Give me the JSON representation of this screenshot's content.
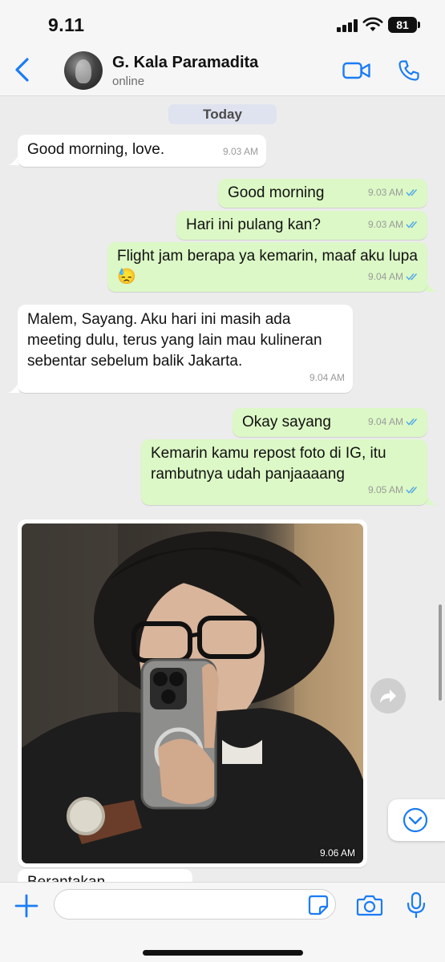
{
  "status_bar": {
    "time": "9.11",
    "battery": "81"
  },
  "header": {
    "contact_name": "G. Kala Paramadita",
    "contact_status": "online",
    "icons": [
      "back-chevron-icon",
      "video-camera-icon",
      "phone-icon"
    ]
  },
  "date_chip": "Today",
  "messages": [
    {
      "direction": "in",
      "text": "Good morning, love.",
      "time": "9.03 AM"
    },
    {
      "direction": "out",
      "text": "Good morning",
      "time": "9.03 AM",
      "status": "read"
    },
    {
      "direction": "out",
      "text": "Hari ini pulang kan?",
      "time": "9.03 AM",
      "status": "read"
    },
    {
      "direction": "out",
      "text": "Flight jam berapa ya kemarin, maaf aku lupa 😓",
      "time": "9.04 AM",
      "status": "read"
    },
    {
      "direction": "in",
      "text": "Malem, Sayang. Aku hari ini masih ada meeting dulu, terus yang lain mau kulineran sebentar sebelum balik Jakarta.",
      "time": "9.04 AM"
    },
    {
      "direction": "out",
      "text": "Okay sayang",
      "time": "9.04 AM",
      "status": "read"
    },
    {
      "direction": "out",
      "text": "Kemarin kamu repost foto di IG, itu rambutnya udah panjaaaang",
      "time": "9.05 AM",
      "status": "read"
    },
    {
      "direction": "in",
      "type": "image",
      "image_desc": "mirror-selfie-photo",
      "time": "9.06 AM"
    },
    {
      "direction": "in",
      "text": "Berantakan",
      "time": ""
    }
  ],
  "colors": {
    "accent": "#1a7cf5",
    "outgoing_bubble": "#dcf8c6",
    "incoming_bubble": "#ffffff",
    "chat_background": "#ececec",
    "read_ticks": "#4fa8e8"
  },
  "input": {
    "placeholder": "",
    "value": ""
  },
  "input_icons": [
    "plus-icon",
    "sticker-icon",
    "camera-icon",
    "microphone-icon"
  ]
}
